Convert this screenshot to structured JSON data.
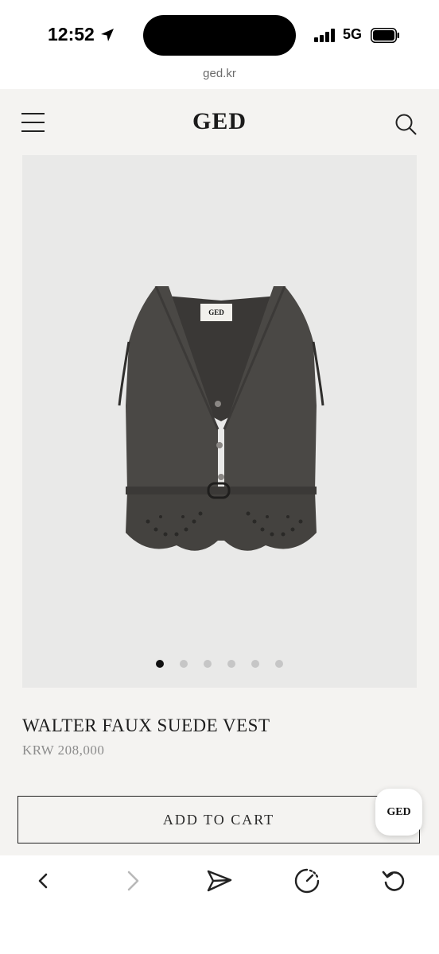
{
  "status_bar": {
    "time": "12:52",
    "network": "5G",
    "location_icon": "location-arrow-icon",
    "signal_icon": "cellular-signal-icon",
    "battery_icon": "battery-icon"
  },
  "browser": {
    "url": "ged.kr"
  },
  "header": {
    "logo": "GED",
    "menu_icon": "hamburger-menu-icon",
    "search_icon": "search-icon"
  },
  "product": {
    "image_alt_icon": "vest-image",
    "carousel_total": 6,
    "carousel_active": 1,
    "title": "WALTER FAUX SUEDE VEST",
    "price": "KRW 208,000",
    "label_text": "GED"
  },
  "actions": {
    "add_to_cart": "ADD TO CART",
    "chat_badge": "GED"
  },
  "toolbar": {
    "items": [
      "back-icon",
      "forward-icon",
      "share-icon",
      "speed-icon",
      "reload-icon"
    ]
  },
  "colors": {
    "page_bg": "#f4f3f1",
    "image_bg": "#e9e9e8",
    "vest": "#4a4845",
    "text": "#1f1f1f",
    "price": "#8c8c8c"
  }
}
